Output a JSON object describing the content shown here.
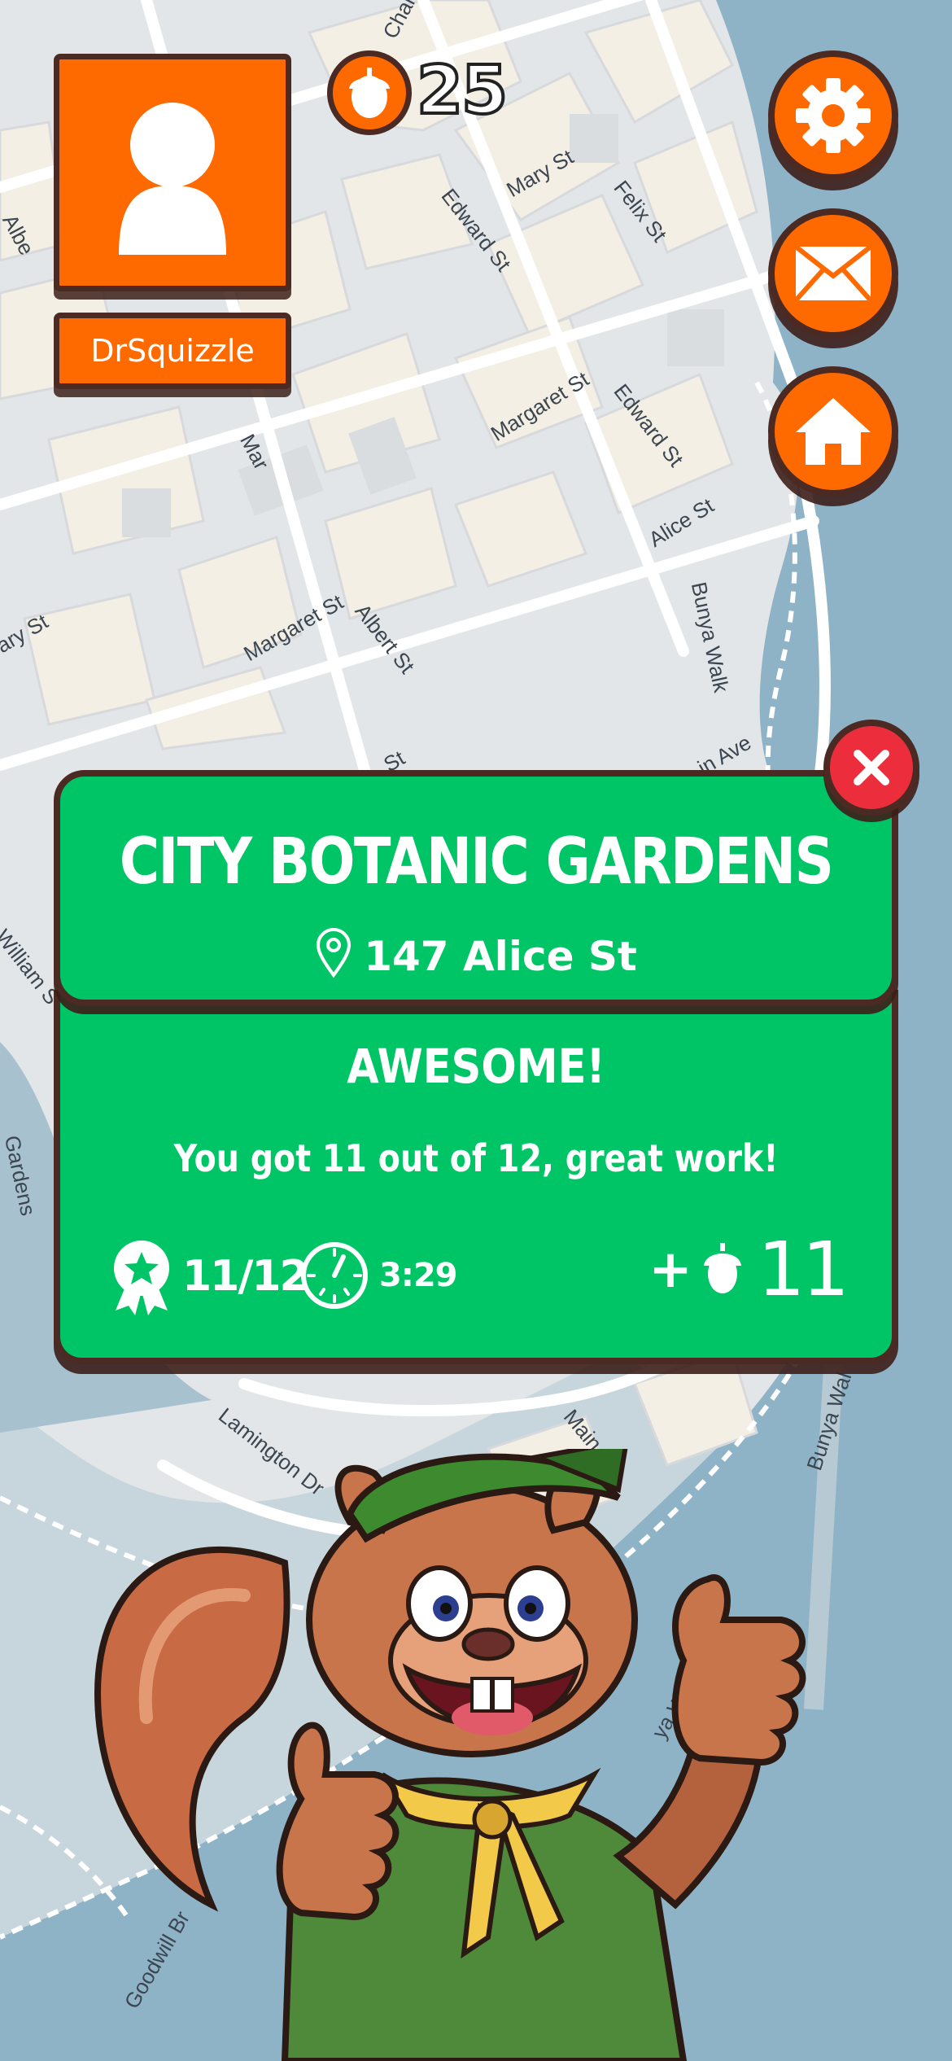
{
  "player": {
    "username": "DrSquizzle",
    "avatar_icon": "user-silhouette-icon",
    "acorns": "25"
  },
  "top_buttons": [
    {
      "name": "settings",
      "icon": "gear-icon"
    },
    {
      "name": "messages",
      "icon": "envelope-icon"
    },
    {
      "name": "home",
      "icon": "house-icon"
    }
  ],
  "map": {
    "streets": [
      {
        "label": "Charlotte"
      },
      {
        "label": "Edward St"
      },
      {
        "label": "Mary St"
      },
      {
        "label": "Felix St"
      },
      {
        "label": "Albe"
      },
      {
        "label": "Margaret St"
      },
      {
        "label": "Edward St"
      },
      {
        "label": "Alice St"
      },
      {
        "label": "Mar"
      },
      {
        "label": "Bunya Walk"
      },
      {
        "label": "Margaret St"
      },
      {
        "label": "Albert St"
      },
      {
        "label": "ary St"
      },
      {
        "label": "St"
      },
      {
        "label": "in Ave"
      },
      {
        "label": "William S"
      },
      {
        "label": "Gardens"
      },
      {
        "label": "Lamington Dr"
      },
      {
        "label": "Main Dr"
      },
      {
        "label": "Bunya Wal"
      },
      {
        "label": "ya Walk"
      },
      {
        "label": "Goodwill Br"
      }
    ]
  },
  "result_card": {
    "location_name": "CITY BOTANIC GARDENS",
    "address": "147 Alice St",
    "headline": "AWESOME!",
    "message": "You got 11 out of 12, great work!",
    "score": "11/12",
    "time": "3:29",
    "reward_prefix": "+",
    "reward_amount": "11",
    "colors": {
      "card": "#00c566",
      "close": "#ec2e3c",
      "accent": "#ff6a00"
    }
  }
}
